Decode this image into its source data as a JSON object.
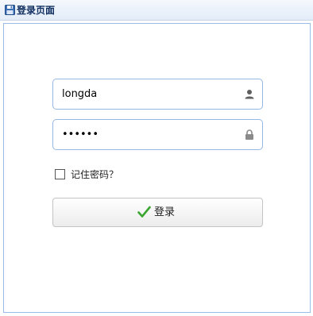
{
  "panel": {
    "title": "登录页面",
    "title_icon": "save-icon"
  },
  "form": {
    "username": {
      "value": "longda",
      "icon": "user-icon"
    },
    "password": {
      "value": "123456",
      "icon": "lock-icon"
    },
    "remember": {
      "label": "记住密码？",
      "checked": false
    },
    "login_button": {
      "label": "登录",
      "icon": "check-icon"
    }
  },
  "colors": {
    "field_border": "#95b8e7",
    "panel_border": "#99bbe8",
    "check_green": "#3aa631"
  }
}
